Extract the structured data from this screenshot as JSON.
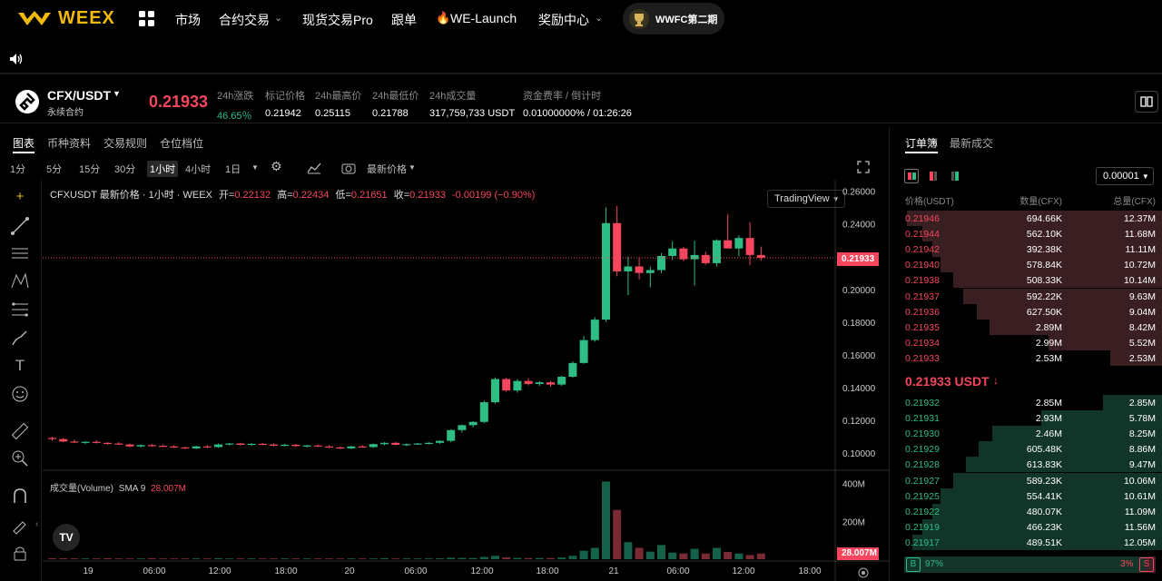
{
  "nav": {
    "logo": "WEEX",
    "items": [
      "市场",
      "合约交易",
      "现货交易Pro",
      "跟单",
      "WE-Launch",
      "奖励中心"
    ],
    "badge": "WWFC第二期"
  },
  "ticker": {
    "symbol": "CFX/USDT",
    "subtitle": "永续合约",
    "last_price": "0.21933",
    "stats": [
      {
        "label": "24h涨跌",
        "value": "46.65％",
        "color": "#2ebd85"
      },
      {
        "label": "标记价格",
        "value": "0.21942",
        "color": "#ffffff"
      },
      {
        "label": "24h最高价",
        "value": "0.25115",
        "color": "#ffffff"
      },
      {
        "label": "24h最低价",
        "value": "0.21788",
        "color": "#ffffff"
      },
      {
        "label": "24h成交量",
        "value": "317,759,733 USDT",
        "color": "#ffffff"
      },
      {
        "label": "资金费率 / 倒计时",
        "value": "0.01000000% / 01:26:26",
        "color": "#ffffff"
      }
    ]
  },
  "chart_panel": {
    "tabs": [
      "图表",
      "币种资料",
      "交易规则",
      "仓位档位"
    ],
    "timeframes": [
      "1分",
      "5分",
      "15分",
      "30分",
      "1小时",
      "4小时",
      "1日"
    ],
    "active_timeframe": "1小时",
    "price_type": "最新价格",
    "view_button": "TradingView",
    "legend_title": "CFXUSDT 最新价格 · 1小时 · WEEX",
    "ohlc": {
      "open_label": "开=",
      "open": "0.22132",
      "high_label": "高=",
      "high": "0.22434",
      "low_label": "低=",
      "low": "0.21651",
      "close_label": "收=",
      "close": "0.21933",
      "change": "-0.00199 (−0.90%)"
    },
    "volume_legend": {
      "label": "成交量(Volume)",
      "sma": "SMA 9",
      "value": "28.007M"
    },
    "current_price_tag": "0.21933",
    "volume_tag": "28.007M"
  },
  "chart_data": {
    "type": "candlestick",
    "x_labels": [
      "19",
      "06:00",
      "12:00",
      "18:00",
      "20",
      "06:00",
      "12:00",
      "18:00",
      "21",
      "06:00",
      "12:00",
      "18:00"
    ],
    "price_axis": [
      "0.26000",
      "0.24000",
      "0.22000",
      "0.20000",
      "0.18000",
      "0.16000",
      "0.14000",
      "0.12000",
      "0.10000"
    ],
    "ylim": [
      0.09,
      0.267
    ],
    "volume_axis": [
      "400M",
      "200M"
    ],
    "candles": [
      [
        0.1092,
        0.11,
        0.1075,
        0.1085
      ],
      [
        0.1085,
        0.1092,
        0.1066,
        0.107
      ],
      [
        0.107,
        0.1082,
        0.1062,
        0.1064
      ],
      [
        0.1064,
        0.1074,
        0.1055,
        0.1068
      ],
      [
        0.1068,
        0.1078,
        0.1058,
        0.1062
      ],
      [
        0.1062,
        0.1066,
        0.105,
        0.1058
      ],
      [
        0.1058,
        0.1066,
        0.1048,
        0.1052
      ],
      [
        0.1052,
        0.1058,
        0.1036,
        0.104
      ],
      [
        0.104,
        0.1052,
        0.1034,
        0.1048
      ],
      [
        0.1048,
        0.1056,
        0.1038,
        0.1044
      ],
      [
        0.1044,
        0.1052,
        0.1036,
        0.104
      ],
      [
        0.104,
        0.1048,
        0.103,
        0.1034
      ],
      [
        0.1034,
        0.104,
        0.1024,
        0.1028
      ],
      [
        0.1028,
        0.1044,
        0.1024,
        0.104
      ],
      [
        0.104,
        0.105,
        0.103,
        0.1036
      ],
      [
        0.1036,
        0.1058,
        0.1032,
        0.1052
      ],
      [
        0.1052,
        0.1062,
        0.1046,
        0.1058
      ],
      [
        0.1058,
        0.1062,
        0.1046,
        0.105
      ],
      [
        0.105,
        0.106,
        0.1044,
        0.1056
      ],
      [
        0.1056,
        0.1062,
        0.1048,
        0.1052
      ],
      [
        0.1052,
        0.1058,
        0.104,
        0.1044
      ],
      [
        0.1044,
        0.1056,
        0.104,
        0.105
      ],
      [
        0.105,
        0.1056,
        0.1038,
        0.1042
      ],
      [
        0.1042,
        0.105,
        0.1034,
        0.1046
      ],
      [
        0.1046,
        0.1052,
        0.1036,
        0.104
      ],
      [
        0.104,
        0.1048,
        0.103,
        0.1034
      ],
      [
        0.1034,
        0.104,
        0.1024,
        0.1028
      ],
      [
        0.1028,
        0.1044,
        0.1024,
        0.104
      ],
      [
        0.104,
        0.1048,
        0.1032,
        0.1036
      ],
      [
        0.1036,
        0.1058,
        0.1032,
        0.1054
      ],
      [
        0.1054,
        0.1066,
        0.1046,
        0.1062
      ],
      [
        0.1062,
        0.1066,
        0.1046,
        0.105
      ],
      [
        0.105,
        0.1058,
        0.1042,
        0.1054
      ],
      [
        0.1054,
        0.1062,
        0.105,
        0.1058
      ],
      [
        0.1058,
        0.1066,
        0.1052,
        0.1062
      ],
      [
        0.1062,
        0.1078,
        0.1056,
        0.1074
      ],
      [
        0.1074,
        0.1145,
        0.1066,
        0.114
      ],
      [
        0.114,
        0.1175,
        0.1124,
        0.117
      ],
      [
        0.117,
        0.1195,
        0.1156,
        0.119
      ],
      [
        0.119,
        0.132,
        0.1182,
        0.131
      ],
      [
        0.131,
        0.1462,
        0.1302,
        0.1452
      ],
      [
        0.1452,
        0.146,
        0.1374,
        0.1382
      ],
      [
        0.1382,
        0.1452,
        0.1368,
        0.144
      ],
      [
        0.144,
        0.1458,
        0.1412,
        0.1422
      ],
      [
        0.1422,
        0.144,
        0.141,
        0.1432
      ],
      [
        0.1432,
        0.144,
        0.1405,
        0.1418
      ],
      [
        0.1418,
        0.1472,
        0.141,
        0.1466
      ],
      [
        0.1466,
        0.156,
        0.146,
        0.155
      ],
      [
        0.155,
        0.1715,
        0.1545,
        0.169
      ],
      [
        0.169,
        0.183,
        0.168,
        0.1815
      ],
      [
        0.1815,
        0.25,
        0.18,
        0.2405
      ],
      [
        0.2405,
        0.251,
        0.208,
        0.211
      ],
      [
        0.211,
        0.22,
        0.1965,
        0.214
      ],
      [
        0.214,
        0.2195,
        0.2062,
        0.21
      ],
      [
        0.21,
        0.214,
        0.2012,
        0.2118
      ],
      [
        0.2118,
        0.2222,
        0.21,
        0.2204
      ],
      [
        0.2204,
        0.2295,
        0.218,
        0.225
      ],
      [
        0.225,
        0.226,
        0.2172,
        0.2184
      ],
      [
        0.2184,
        0.2298,
        0.2024,
        0.221
      ],
      [
        0.221,
        0.223,
        0.215,
        0.216
      ],
      [
        0.216,
        0.2306,
        0.214,
        0.23
      ],
      [
        0.23,
        0.246,
        0.225,
        0.225
      ],
      [
        0.225,
        0.233,
        0.22,
        0.2314
      ],
      [
        0.2314,
        0.241,
        0.215,
        0.221
      ],
      [
        0.221,
        0.2262,
        0.2176,
        0.2193
      ]
    ],
    "volumes": [
      5,
      5,
      4,
      4,
      4,
      5,
      4,
      4,
      4,
      5,
      4,
      4,
      4,
      4,
      4,
      5,
      4,
      4,
      4,
      4,
      4,
      4,
      4,
      4,
      4,
      4,
      4,
      4,
      4,
      4,
      5,
      4,
      4,
      4,
      4,
      5,
      8,
      7,
      6,
      12,
      18,
      10,
      7,
      6,
      6,
      6,
      9,
      18,
      45,
      60,
      410,
      260,
      90,
      60,
      40,
      75,
      35,
      30,
      55,
      30,
      60,
      38,
      30,
      22,
      30
    ],
    "volume_ylim": [
      0,
      460
    ]
  },
  "orderbook": {
    "tabs": [
      "订单簿",
      "最新成交"
    ],
    "precision": "0.00001",
    "headers": [
      "价格(USDT)",
      "数量(CFX)",
      "总量(CFX)"
    ],
    "asks": [
      {
        "price": "0.21946",
        "qty": "694.66K",
        "total": "12.37M",
        "depth": 0.99
      },
      {
        "price": "0.21944",
        "qty": "562.10K",
        "total": "11.68M",
        "depth": 0.93
      },
      {
        "price": "0.21942",
        "qty": "392.38K",
        "total": "11.11M",
        "depth": 0.89
      },
      {
        "price": "0.21940",
        "qty": "578.84K",
        "total": "10.72M",
        "depth": 0.86
      },
      {
        "price": "0.21938",
        "qty": "508.33K",
        "total": "10.14M",
        "depth": 0.81
      },
      {
        "price": "0.21937",
        "qty": "592.22K",
        "total": "9.63M",
        "depth": 0.77
      },
      {
        "price": "0.21936",
        "qty": "627.50K",
        "total": "9.04M",
        "depth": 0.72
      },
      {
        "price": "0.21935",
        "qty": "2.89M",
        "total": "8.42M",
        "depth": 0.67
      },
      {
        "price": "0.21934",
        "qty": "2.99M",
        "total": "5.52M",
        "depth": 0.44
      },
      {
        "price": "0.21933",
        "qty": "2.53M",
        "total": "2.53M",
        "depth": 0.2
      }
    ],
    "last_price": "0.21933 USDT",
    "bids": [
      {
        "price": "0.21932",
        "qty": "2.85M",
        "total": "2.85M",
        "depth": 0.23
      },
      {
        "price": "0.21931",
        "qty": "2.93M",
        "total": "5.78M",
        "depth": 0.47
      },
      {
        "price": "0.21930",
        "qty": "2.46M",
        "total": "8.25M",
        "depth": 0.66
      },
      {
        "price": "0.21929",
        "qty": "605.48K",
        "total": "8.86M",
        "depth": 0.71
      },
      {
        "price": "0.21928",
        "qty": "613.83K",
        "total": "9.47M",
        "depth": 0.76
      },
      {
        "price": "0.21927",
        "qty": "589.23K",
        "total": "10.06M",
        "depth": 0.81
      },
      {
        "price": "0.21925",
        "qty": "554.41K",
        "total": "10.61M",
        "depth": 0.86
      },
      {
        "price": "0.21922",
        "qty": "480.07K",
        "total": "11.09M",
        "depth": 0.89
      },
      {
        "price": "0.21919",
        "qty": "466.23K",
        "total": "11.56M",
        "depth": 0.93
      },
      {
        "price": "0.21917",
        "qty": "489.51K",
        "total": "12.05M",
        "depth": 0.97
      }
    ],
    "buy_label": "B",
    "buy_pct": "97%",
    "sell_pct": "3%",
    "sell_label": "S"
  },
  "colors": {
    "up": "#2ebd85",
    "down": "#f6465d",
    "brand": "#f0b90b"
  }
}
